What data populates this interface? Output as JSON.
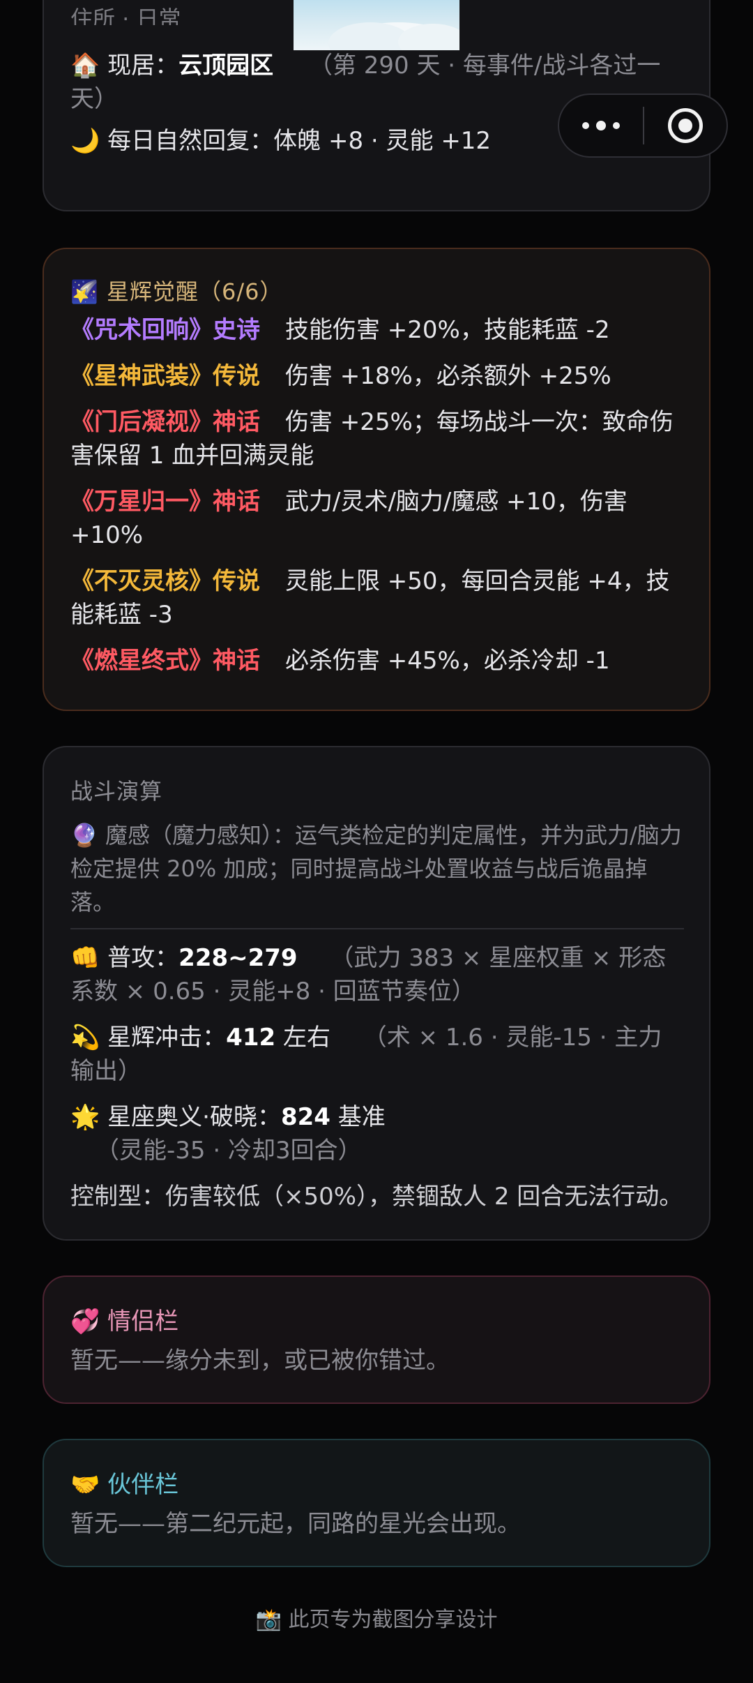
{
  "residence": {
    "cut_label": "住所 · 日常",
    "home_icon": "🏠",
    "home_label": "现居：",
    "home_place": "云顶园区",
    "home_note": "（第 290 天 · 每事件/战斗各过一天）",
    "moon_icon": "🌙",
    "recovery": "每日自然回复：体魄 +8 · 灵能 +12"
  },
  "star": {
    "icon": "🌠",
    "title": "星辉觉醒（6/6）",
    "items": [
      {
        "name": "《咒术回响》史诗",
        "desc": "技能伤害 +20%，技能耗蓝 -2"
      },
      {
        "name": "《星神武装》传说",
        "desc": "伤害 +18%，必杀额外 +25%"
      },
      {
        "name": "《门后凝视》神话",
        "desc": "伤害 +25%；每场战斗一次：致命伤害保留 1 血并回满灵能"
      },
      {
        "name": "《万星归一》神话",
        "desc": "武力/灵术/脑力/魔感 +10，伤害 +10%"
      },
      {
        "name": "《不灭灵核》传说",
        "desc": "灵能上限 +50，每回合灵能 +4，技能耗蓝 -3"
      },
      {
        "name": "《燃星终式》神话",
        "desc": "必杀伤害 +45%，必杀冷却 -1"
      }
    ]
  },
  "battle": {
    "title": "战斗演算",
    "desc_icon": "🔮",
    "desc": "魔感（魔力感知）：运气类检定的判定属性，并为武力/脑力检定提供 20% 加成；同时提高战斗处置收益与战后诡晶掉落。",
    "attack_icon": "👊",
    "attack_label": "普攻：",
    "attack_value": "228~279",
    "attack_note": "（武力 383 × 星座权重 × 形态系数 × 0.65 · 灵能+8 · 回蓝节奏位）",
    "impact_icon": "💫",
    "impact_label": "星辉冲击：",
    "impact_value": "412",
    "impact_suffix": " 左右",
    "impact_note": "（术 × 1.6 · 灵能-15 · 主力输出）",
    "ult_icon": "🌟",
    "ult_label": "星座奥义·破晓：",
    "ult_value": "824",
    "ult_suffix": " 基准",
    "ult_note": "（灵能-35 · 冷却3回合）",
    "control": "控制型：伤害较低（×50%），禁锢敌人 2 回合无法行动。"
  },
  "lovers": {
    "icon": "💞",
    "title": "情侣栏",
    "text": "暂无——缘分未到，或已被你错过。"
  },
  "partner": {
    "icon": "🤝",
    "title": "伙伴栏",
    "text": "暂无——第二纪元起，同路的星光会出现。"
  },
  "footer": {
    "icon": "📸",
    "text": "此页专为截图分享设计"
  },
  "colors": {
    "epic": "#b47cff",
    "legend": "#f4b83a",
    "myth": "#ff5a63"
  }
}
